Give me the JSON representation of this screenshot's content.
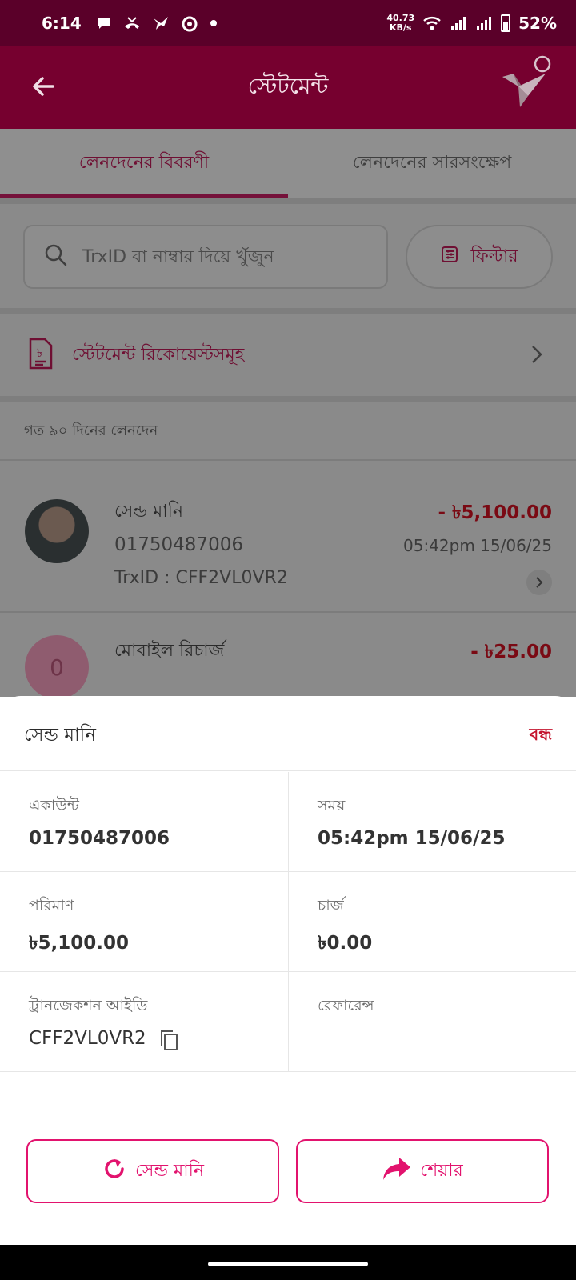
{
  "status_bar": {
    "time": "6:14",
    "net_speed_value": "40.73",
    "net_speed_unit": "KB/s",
    "battery": "52%"
  },
  "app_bar": {
    "title": "স্টেটমেন্ট"
  },
  "tabs": [
    {
      "label": "লেনদেনের বিবরণী",
      "active": true
    },
    {
      "label": "লেনদেনের সারসংক্ষেপ",
      "active": false
    }
  ],
  "search": {
    "placeholder": "TrxID বা নাম্বার দিয়ে খুঁজুন",
    "value": ""
  },
  "filter": {
    "label": "ফিল্টার"
  },
  "statement_requests": {
    "label": "স্টেটমেন্ট রিকোয়েস্টসমূহ"
  },
  "section_label": "গত ৯০ দিনের লেনদেন",
  "transactions": [
    {
      "name": "সেন্ড মানি",
      "number": "01750487006",
      "trx": "TrxID : CFF2VL0VR2",
      "amount": "- ৳5,100.00",
      "datetime": "05:42pm 15/06/25"
    },
    {
      "avatar_letter": "0",
      "name": "মোবাইল রিচার্জ",
      "amount": "- ৳25.00"
    }
  ],
  "sheet": {
    "title": "সেন্ড মানি",
    "close_label": "বন্ধ",
    "fields": {
      "account_label": "একাউন্ট",
      "account_value": "01750487006",
      "time_label": "সময়",
      "time_value": "05:42pm 15/06/25",
      "amount_label": "পরিমাণ",
      "amount_value": "৳5,100.00",
      "charge_label": "চার্জ",
      "charge_value": "৳0.00",
      "trxid_label": "ট্রানজেকশন আইডি",
      "trxid_value": "CFF2VL0VR2",
      "reference_label": "রেফারেন্স",
      "reference_value": ""
    },
    "buttons": {
      "send_money": "সেন্ড মানি",
      "share": "শেয়ার"
    }
  },
  "colors": {
    "status_bar": "#5a0029",
    "app_bar": "#76002f",
    "brand_pink": "#e2136e",
    "close_red": "#c4142e"
  }
}
